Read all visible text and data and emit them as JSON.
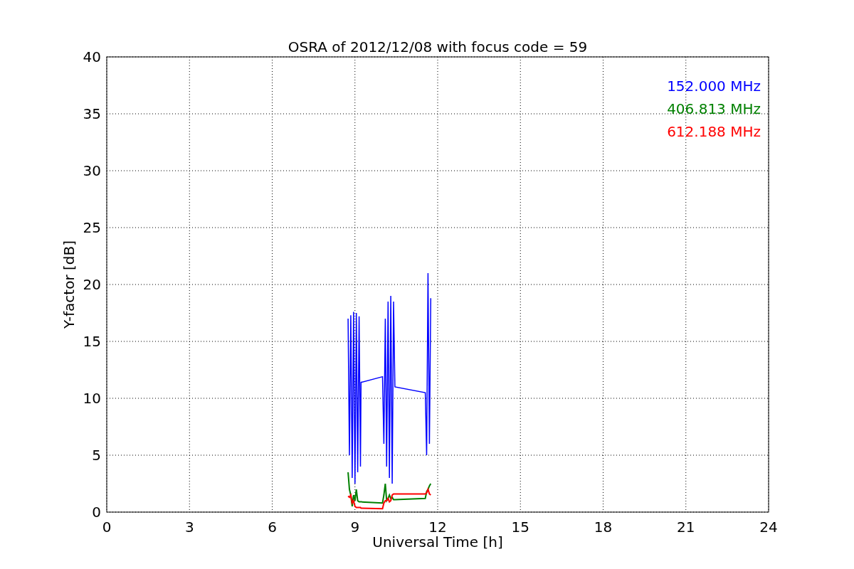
{
  "chart_data": {
    "type": "line",
    "title": "OSRA of 2012/12/08 with focus code = 59",
    "xlabel": "Universal Time [h]",
    "ylabel": "Y-factor [dB]",
    "x": [
      8.75,
      8.8,
      8.85,
      8.9,
      8.95,
      9.0,
      9.05,
      9.1,
      9.15,
      9.2,
      9.22,
      10.0,
      10.05,
      10.1,
      10.15,
      10.2,
      10.25,
      10.3,
      10.35,
      10.4,
      10.45,
      11.55,
      11.6,
      11.65,
      11.7,
      11.75
    ],
    "series": [
      {
        "name": "152.000 MHz",
        "color": "#0000ff",
        "values": [
          17,
          5,
          17.3,
          3,
          17.6,
          2.5,
          17.5,
          3.5,
          17.2,
          4,
          11.4,
          11.9,
          6,
          17,
          4,
          18.5,
          3,
          19,
          2.5,
          18.5,
          11,
          10.5,
          5,
          21,
          6,
          18.8
        ]
      },
      {
        "name": "406.813 MHz",
        "color": "#008000",
        "values": [
          3.5,
          2,
          1.5,
          0.5,
          1.5,
          1,
          2,
          1,
          0.9,
          0.9,
          0.9,
          0.8,
          1.5,
          2.5,
          1,
          1.2,
          1.5,
          1.2,
          1.3,
          1.1,
          1.1,
          1.2,
          1.8,
          2,
          2.3,
          2.5
        ]
      },
      {
        "name": "612.188 MHz",
        "color": "#ff0000",
        "values": [
          1.4,
          1.3,
          1.5,
          0.8,
          1,
          0.5,
          0.4,
          0.4,
          0.4,
          0.4,
          0.35,
          0.3,
          0.8,
          1,
          1,
          1.2,
          0.9,
          1,
          1.5,
          1.6,
          1.6,
          1.6,
          1.7,
          2,
          1.6,
          1.5
        ]
      }
    ],
    "xlim": [
      0,
      24
    ],
    "ylim": [
      0,
      40
    ],
    "xticks": [
      0,
      3,
      6,
      9,
      12,
      15,
      18,
      21,
      24
    ],
    "yticks": [
      0,
      5,
      10,
      15,
      20,
      25,
      30,
      35,
      40
    ],
    "grid": true
  }
}
